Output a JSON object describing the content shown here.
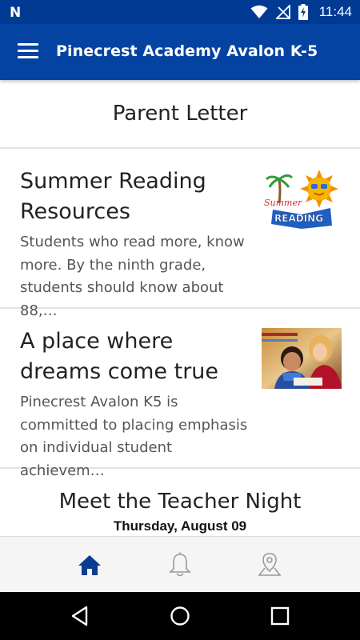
{
  "status_bar": {
    "left_icon": "n-notification-icon",
    "time": "11:44"
  },
  "app_bar": {
    "title": "Pinecrest Academy Avalon K-5",
    "menu_icon": "hamburger-menu-icon"
  },
  "section": {
    "title": "Parent Letter"
  },
  "cards": [
    {
      "title": "Summer Reading Resources",
      "summary": "Students who read more, know more. By the ninth grade, students should know about 88,…",
      "thumbnail": "summer-reading-logo",
      "thumbnail_text_top": "Summer",
      "thumbnail_text_bottom": "READING"
    },
    {
      "title": "A place where dreams come true",
      "summary": "Pinecrest Avalon K5 is committed to placing emphasis on individual student achievem…",
      "thumbnail": "teacher-student-photo"
    }
  ],
  "event": {
    "title": "Meet the Teacher Night",
    "date": "Thursday, August 09"
  },
  "bottom_nav": {
    "items": [
      {
        "icon": "home-icon",
        "active": true
      },
      {
        "icon": "bell-icon",
        "active": false
      },
      {
        "icon": "map-pin-icon",
        "active": false
      }
    ],
    "active_color": "#0a3d91",
    "inactive_color": "#9a9a9a"
  },
  "colors": {
    "status_bar": "#003a93",
    "app_bar": "#0543a3"
  }
}
